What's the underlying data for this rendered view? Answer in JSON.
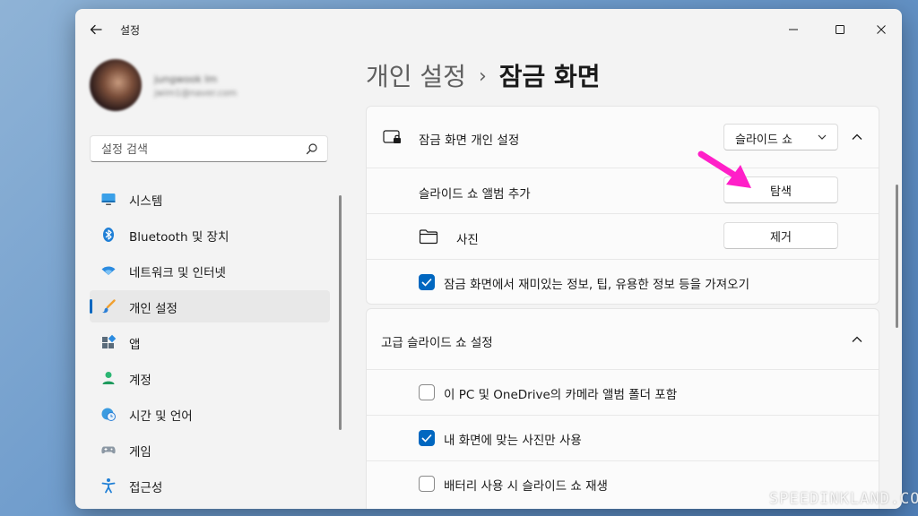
{
  "window": {
    "title": "설정"
  },
  "profile": {
    "name": "jungwook Im",
    "email": "jwim1@naver.com"
  },
  "search": {
    "placeholder": "설정 검색"
  },
  "sidebar": {
    "items": [
      {
        "label": "시스템",
        "icon": "monitor-icon"
      },
      {
        "label": "Bluetooth 및 장치",
        "icon": "bluetooth-icon"
      },
      {
        "label": "네트워크 및 인터넷",
        "icon": "wifi-icon"
      },
      {
        "label": "개인 설정",
        "icon": "brush-icon",
        "active": true
      },
      {
        "label": "앱",
        "icon": "apps-icon"
      },
      {
        "label": "계정",
        "icon": "person-icon"
      },
      {
        "label": "시간 및 언어",
        "icon": "globe-clock-icon"
      },
      {
        "label": "게임",
        "icon": "gamepad-icon"
      },
      {
        "label": "접근성",
        "icon": "accessibility-icon"
      }
    ]
  },
  "breadcrumb": {
    "parent": "개인 설정",
    "separator": "›",
    "current": "잠금 화면"
  },
  "lockscreen_card": {
    "header_label": "잠금 화면 개인 설정",
    "dropdown_value": "슬라이드 쇼",
    "add_album_label": "슬라이드 쇼 앨범 추가",
    "browse_button": "탐색",
    "folder_label": "사진",
    "remove_button": "제거",
    "fun_facts_label": "잠금 화면에서 재미있는 정보, 팁, 유용한 정보 등을 가져오기",
    "fun_facts_checked": true
  },
  "advanced_card": {
    "header_label": "고급 슬라이드 쇼 설정",
    "options": [
      {
        "label": "이 PC 및 OneDrive의 카메라 앨범 폴더 포함",
        "checked": false
      },
      {
        "label": "내 화면에 맞는 사진만 사용",
        "checked": true
      },
      {
        "label": "배터리 사용 시 슬라이드 쇼 재생",
        "checked": false
      }
    ]
  },
  "colors": {
    "accent": "#0067c0",
    "annotation_arrow": "#ff1fc8"
  },
  "watermark": "SPEEDINKLAND.COM"
}
